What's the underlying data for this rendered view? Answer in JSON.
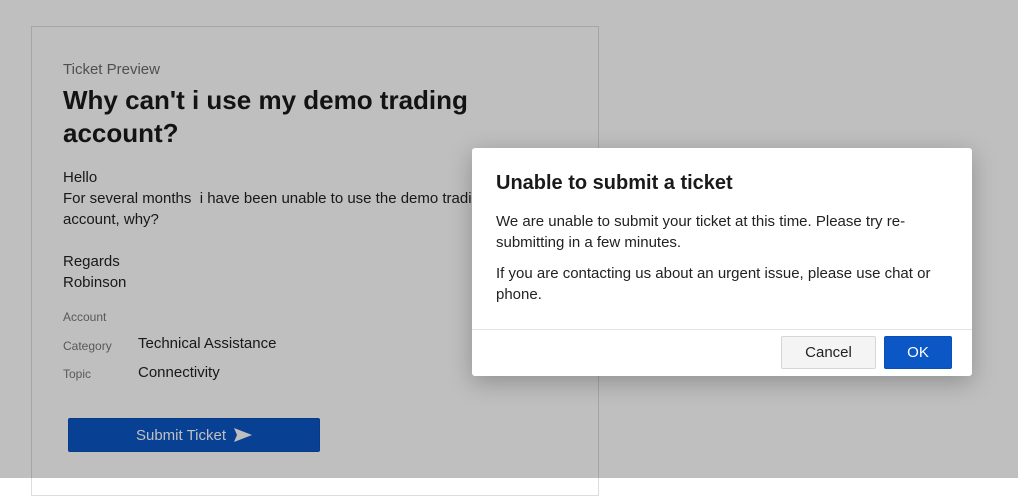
{
  "ticket": {
    "eyebrow": "Ticket Preview",
    "title": "Why can't i use my demo trading account?",
    "body_lines": [
      "Hello",
      "For several months  i have been unable to use the demo trading",
      "account, why?",
      "",
      "Regards",
      "Robinson"
    ],
    "meta": [
      {
        "label": "Account",
        "value": ""
      },
      {
        "label": "Category",
        "value": "Technical Assistance"
      },
      {
        "label": "Topic",
        "value": "Connectivity"
      }
    ],
    "submit_label": "Submit Ticket",
    "submit_icon": "send-arrow-icon"
  },
  "modal": {
    "title": "Unable to submit a ticket",
    "paragraphs": [
      "We are unable to submit your ticket at this time. Please try re-submitting in a few minutes.",
      "If you are contacting us about an urgent issue, please use chat or phone."
    ],
    "cancel_label": "Cancel",
    "ok_label": "OK"
  },
  "colors": {
    "primary": "#0b57c6",
    "overlay": "rgba(0,0,0,0.25)",
    "background": "#ffffff"
  }
}
